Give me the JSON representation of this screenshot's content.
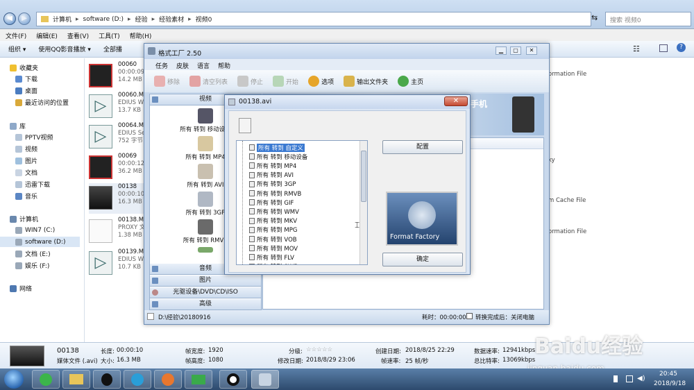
{
  "explorer": {
    "breadcrumbs": [
      "计算机",
      "software (D:)",
      "经验",
      "经验素材",
      "视频0"
    ],
    "search_placeholder": "搜索 视频0",
    "menu": [
      "文件(F)",
      "编辑(E)",
      "查看(V)",
      "工具(T)",
      "帮助(H)"
    ],
    "toolbar": [
      "组织 ▾",
      "使用QQ影音播放 ▾",
      "全部播"
    ],
    "sidebar": {
      "favorites": "收藏夹",
      "fav_items": [
        "下载",
        "桌面",
        "最近访问的位置"
      ],
      "library": "库",
      "lib_items": [
        "PPTV视频",
        "视频",
        "图片",
        "文档",
        "迅雷下载",
        "音乐"
      ],
      "computer": "计算机",
      "drives": [
        "WIN7 (C:)",
        "software (D:)",
        "文档 (E:)",
        "娱乐 (F:)"
      ],
      "network": "网络"
    },
    "files": [
      {
        "name": "00060",
        "l2": "00:00:09",
        "l3": "14.2 MB",
        "kind": "red"
      },
      {
        "name": "00060.MT",
        "l2": "EDIUS W",
        "l3": "13.7 KB",
        "kind": "play"
      },
      {
        "name": "00064.MT",
        "l2": "EDIUS Se",
        "l3": "752 字节",
        "kind": "play"
      },
      {
        "name": "00069",
        "l2": "00:00:12",
        "l3": "36.2 MB",
        "kind": "red"
      },
      {
        "name": "00138",
        "l2": "00:00:10",
        "l3": "16.3 MB",
        "kind": "car"
      },
      {
        "name": "00138.MT",
        "l2": "PROXY 文",
        "l3": "1.38 MB",
        "kind": "doc"
      },
      {
        "name": "00139.MT",
        "l2": "EDIUS W",
        "l3": "10.7 KB",
        "kind": "play"
      }
    ],
    "right_texts": [
      "ormation File",
      "ky",
      "m Cache File",
      "ormation File"
    ],
    "details": {
      "name": "00138",
      "type": "媒体文件 (.avi)",
      "length_label": "长度:",
      "length": "00:00:10",
      "size_label": "大小:",
      "size": "16.3 MB",
      "fw_label": "帧宽度:",
      "fw": "1920",
      "fh_label": "帧高度:",
      "fh": "1080",
      "rating_label": "分级:",
      "rating": "☆☆☆☆☆",
      "mdate_label": "修改日期:",
      "mdate": "2018/8/29 23:06",
      "cdate_label": "创建日期:",
      "cdate": "2018/8/25 22:29",
      "fps_label": "帧速率:",
      "fps": "25 帧/秒",
      "datarate_label": "数据速率:",
      "datarate": "12941kbps",
      "bitrate_label": "总比特率:",
      "bitrate": "13069kbps"
    }
  },
  "ff": {
    "title": "格式工厂 2.50",
    "menu": [
      "任务",
      "皮肤",
      "语言",
      "帮助"
    ],
    "toolbar": [
      {
        "label": "移除",
        "dim": true,
        "color": "#d66"
      },
      {
        "label": "清空列表",
        "dim": true,
        "color": "#c33"
      },
      {
        "label": "停止",
        "dim": true,
        "color": "#999"
      },
      {
        "label": "开始",
        "dim": true,
        "color": "#7b7"
      },
      {
        "label": "选项",
        "dim": false,
        "color": "#e6a52a"
      },
      {
        "label": "输出文件夹",
        "dim": false,
        "color": "#d9b34c"
      },
      {
        "label": "主页",
        "dim": false,
        "color": "#4aa84a"
      }
    ],
    "cat_video": "视频",
    "video_items": [
      "所有 转到 移动设备",
      "所有 转到 MP4",
      "所有 转到 AVI",
      "所有 转到 3GP",
      "所有 转到 RMVB"
    ],
    "cats_bottom": [
      "音频",
      "图片",
      "光驱设备\\DVD\\CD\\ISO",
      "高级"
    ],
    "banner_text": "手机",
    "status_path": "D:\\经验\\20180916",
    "status_time": "耗时：00:00:00",
    "status_after": "转换完成后：关闭电脑"
  },
  "dialog": {
    "title": "00138.avi",
    "close": "✕",
    "formats": [
      "所有 转到 自定义",
      "所有 转到 移动设备",
      "所有 转到 MP4",
      "所有 转到 AVI",
      "所有 转到 3GP",
      "所有 转到 RMVB",
      "所有 转到 GIF",
      "所有 转到 WMV",
      "所有 转到 MKV",
      "所有 转到 MPG",
      "所有 转到 VOB",
      "所有 转到 MOV",
      "所有 转到 FLV",
      "所有 转到 SWF"
    ],
    "config_button": "配置",
    "ok_button": "确定",
    "logo_text": "Format Factory"
  },
  "taskbar": {
    "time": "20:45",
    "date": "2018/9/18"
  },
  "watermark": {
    "brand": "Baidu经验",
    "url": "jingyan.baidu.com"
  }
}
